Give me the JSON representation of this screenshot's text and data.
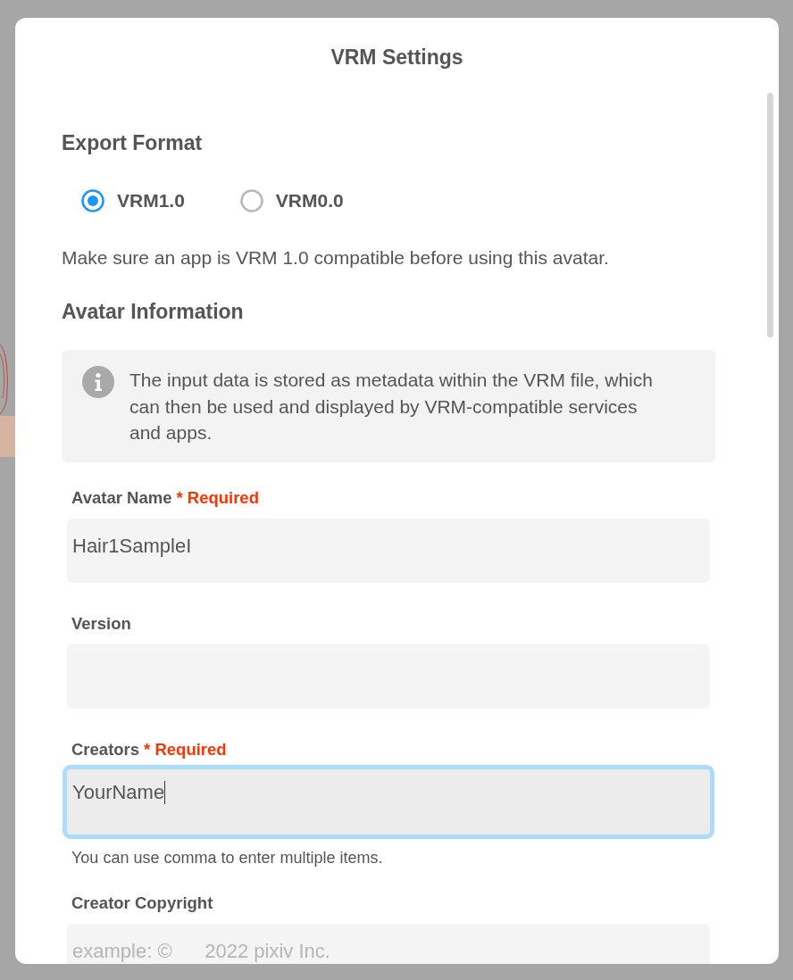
{
  "dialog": {
    "title": "VRM Settings"
  },
  "export_format": {
    "heading": "Export Format",
    "options": [
      {
        "label": "VRM1.0",
        "selected": true
      },
      {
        "label": "VRM0.0",
        "selected": false
      }
    ],
    "note": "Make sure an app is VRM 1.0 compatible before using this avatar."
  },
  "avatar_information": {
    "heading": "Avatar Information",
    "info": "The input data is stored as metadata within the VRM file, which can then be used and displayed by VRM-compatible services and apps.",
    "fields": [
      {
        "label": "Avatar Name",
        "required": "* Required",
        "value": "Hair1SampleI",
        "focused": false
      },
      {
        "label": "Version",
        "focused": false
      },
      {
        "label": "Creators",
        "required": "* Required",
        "value": "YourName",
        "focused": true,
        "hint": "You can use comma to enter multiple items."
      },
      {
        "label": "Creator Copyright",
        "placeholder": "example: ©      2022 pixiv Inc.",
        "focused": false
      }
    ]
  }
}
